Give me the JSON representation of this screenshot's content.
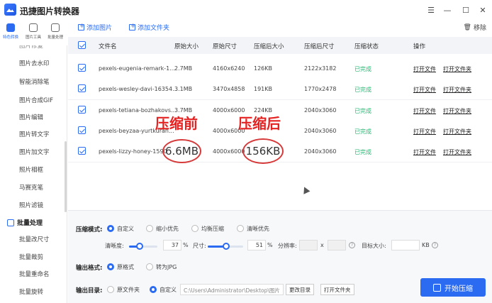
{
  "app": {
    "title": "迅捷图片转换器",
    "controls": [
      "☰",
      "—",
      "☐",
      "✕"
    ]
  },
  "rail": [
    {
      "label": "特色转换",
      "active": true
    },
    {
      "label": "图片工具",
      "active": false
    },
    {
      "label": "批量处理",
      "active": false
    }
  ],
  "sidebar": {
    "items_top": [
      "图片去水印",
      "智能消除笔",
      "图片合成GIF",
      "图片编辑",
      "图片转文字",
      "图片加文字",
      "照片相框",
      "马赛克笔",
      "照片滤镜"
    ],
    "section": "批量处理",
    "items_bottom": [
      "批量改尺寸",
      "批量裁剪",
      "批量重命名",
      "批量旋转"
    ]
  },
  "toolbar": {
    "add_image": "添加图片",
    "add_folder": "添加文件夹",
    "remove": "移除"
  },
  "table": {
    "headers": [
      "文件名",
      "原始大小",
      "原始尺寸",
      "压缩后大小",
      "压缩后尺寸",
      "压缩状态",
      "操作"
    ],
    "rows": [
      {
        "name": "pexels-eugenia-remark-1...",
        "orig_size": "2.7MB",
        "orig_dim": "4160x6240",
        "new_size": "126KB",
        "new_dim": "2122x3182",
        "status": "已完成",
        "open_file": "打开文件",
        "open_folder": "打开文件夹"
      },
      {
        "name": "pexels-wesley-davi-16354...",
        "orig_size": "3.1MB",
        "orig_dim": "3470x4858",
        "new_size": "191KB",
        "new_dim": "1770x2478",
        "status": "已完成",
        "open_file": "打开文件",
        "open_folder": "打开文件夹"
      },
      {
        "name": "pexels-tetiana-bozhakovs...",
        "orig_size": "3.7MB",
        "orig_dim": "4000x6000",
        "new_size": "224KB",
        "new_dim": "2040x3060",
        "status": "已完成",
        "open_file": "打开文件",
        "open_folder": "打开文件夹"
      },
      {
        "name": "pexels-beyzaa-yurtkuran...",
        "orig_size": "",
        "orig_dim": "4000x6000",
        "new_size": "",
        "new_dim": "2040x3060",
        "status": "已完成",
        "open_file": "打开文件",
        "open_folder": "打开文件夹"
      },
      {
        "name": "pexels-lizzy-honey-1590",
        "orig_size": "",
        "orig_dim": "4000x6000",
        "new_size": "",
        "new_dim": "2040x3060",
        "status": "已完成",
        "open_file": "打开文件",
        "open_folder": "打开文件夹"
      }
    ]
  },
  "annotation": {
    "before": "压缩前",
    "after": "压缩后",
    "before_value": "6.6MB",
    "after_value": "156KB",
    "color": "#e52222"
  },
  "settings": {
    "mode_label": "压缩模式:",
    "modes": [
      "自定义",
      "缩小优先",
      "均衡压缩",
      "清晰优先"
    ],
    "clarity_label": "清晰度:",
    "clarity_value": "37",
    "clarity_unit": "%",
    "clarity_level": 0.37,
    "size_label": "尺寸:",
    "size_value": "51",
    "size_unit": "%",
    "size_level": 0.51,
    "resolution_label": "分辨率:",
    "times": "x",
    "target_label": "目标大小:",
    "target_unit": "KB",
    "format_label": "输出格式:",
    "formats": [
      "原格式",
      "转为JPG"
    ],
    "dir_label": "输出目录:",
    "dirs": [
      "原文件夹",
      "自定义"
    ],
    "path": "C:\\Users\\Administrator\\Desktop\\图片",
    "change_dir": "更改目录",
    "open_folder": "打开文件夹",
    "start": "开始压缩"
  },
  "colors": {
    "accent": "#2a6bf2",
    "done": "#2bb673",
    "annotation": "#e52222"
  }
}
